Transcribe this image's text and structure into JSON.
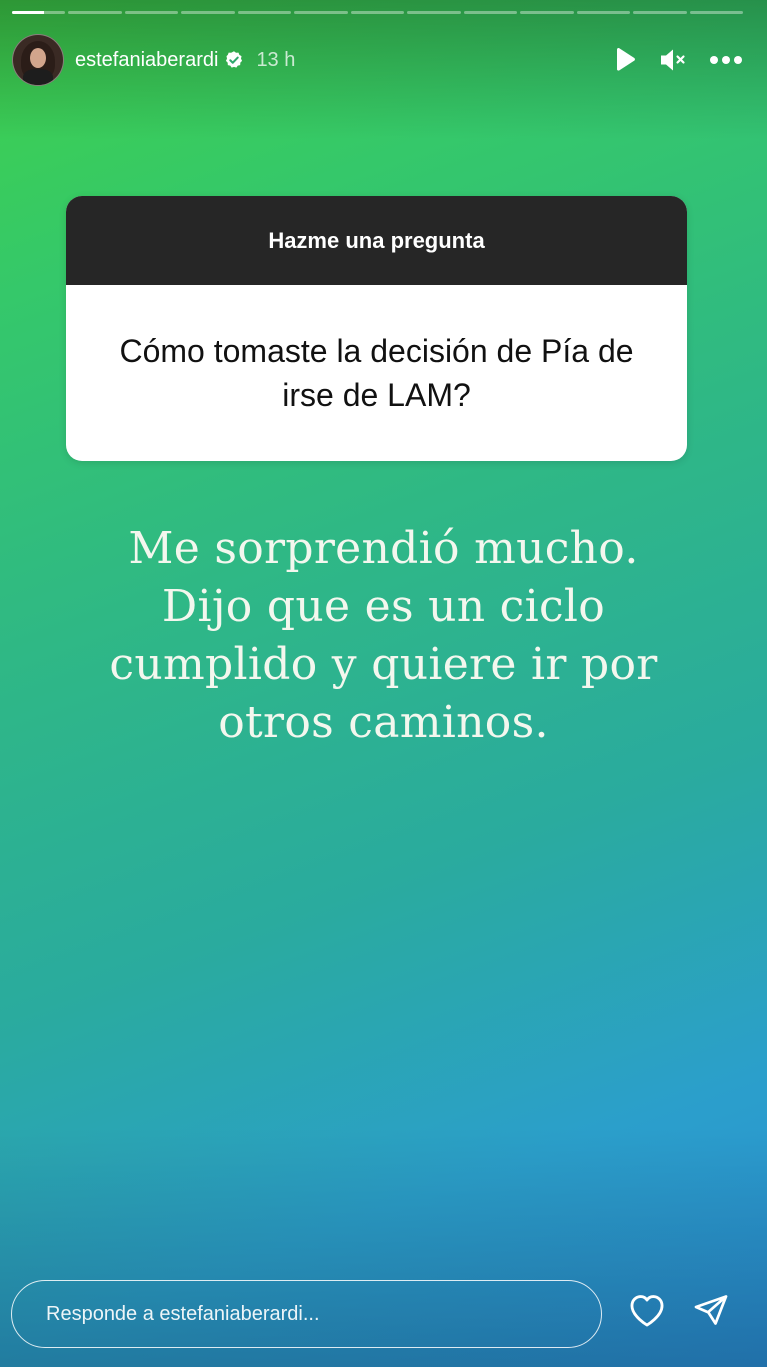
{
  "story": {
    "progress": {
      "segments": 13,
      "current_index": 0,
      "current_fill": 0.6
    },
    "header": {
      "username": "estefaniaberardi",
      "time": "13 h",
      "verified": true
    },
    "question_sticker": {
      "title": "Hazme una pregunta",
      "question": "Cómo tomaste la decisión de Pía de irse de LAM?"
    },
    "answer": {
      "lines": [
        "Me sorprendió mucho.",
        "Dijo que es un ciclo",
        "cumplido y quiere ir por",
        "otros caminos."
      ]
    },
    "reply": {
      "placeholder": "Responde a estefaniaberardi..."
    },
    "icons": {
      "play": "play-icon",
      "mute": "mute-icon",
      "more": "more-icon",
      "like": "heart-icon",
      "share": "send-icon",
      "verified": "verified-badge-icon"
    },
    "colors": {
      "gradient_top": "#3fd14a",
      "gradient_bottom": "#2a8fd8",
      "sticker_header": "#262626",
      "verified": "#ffffff"
    }
  }
}
